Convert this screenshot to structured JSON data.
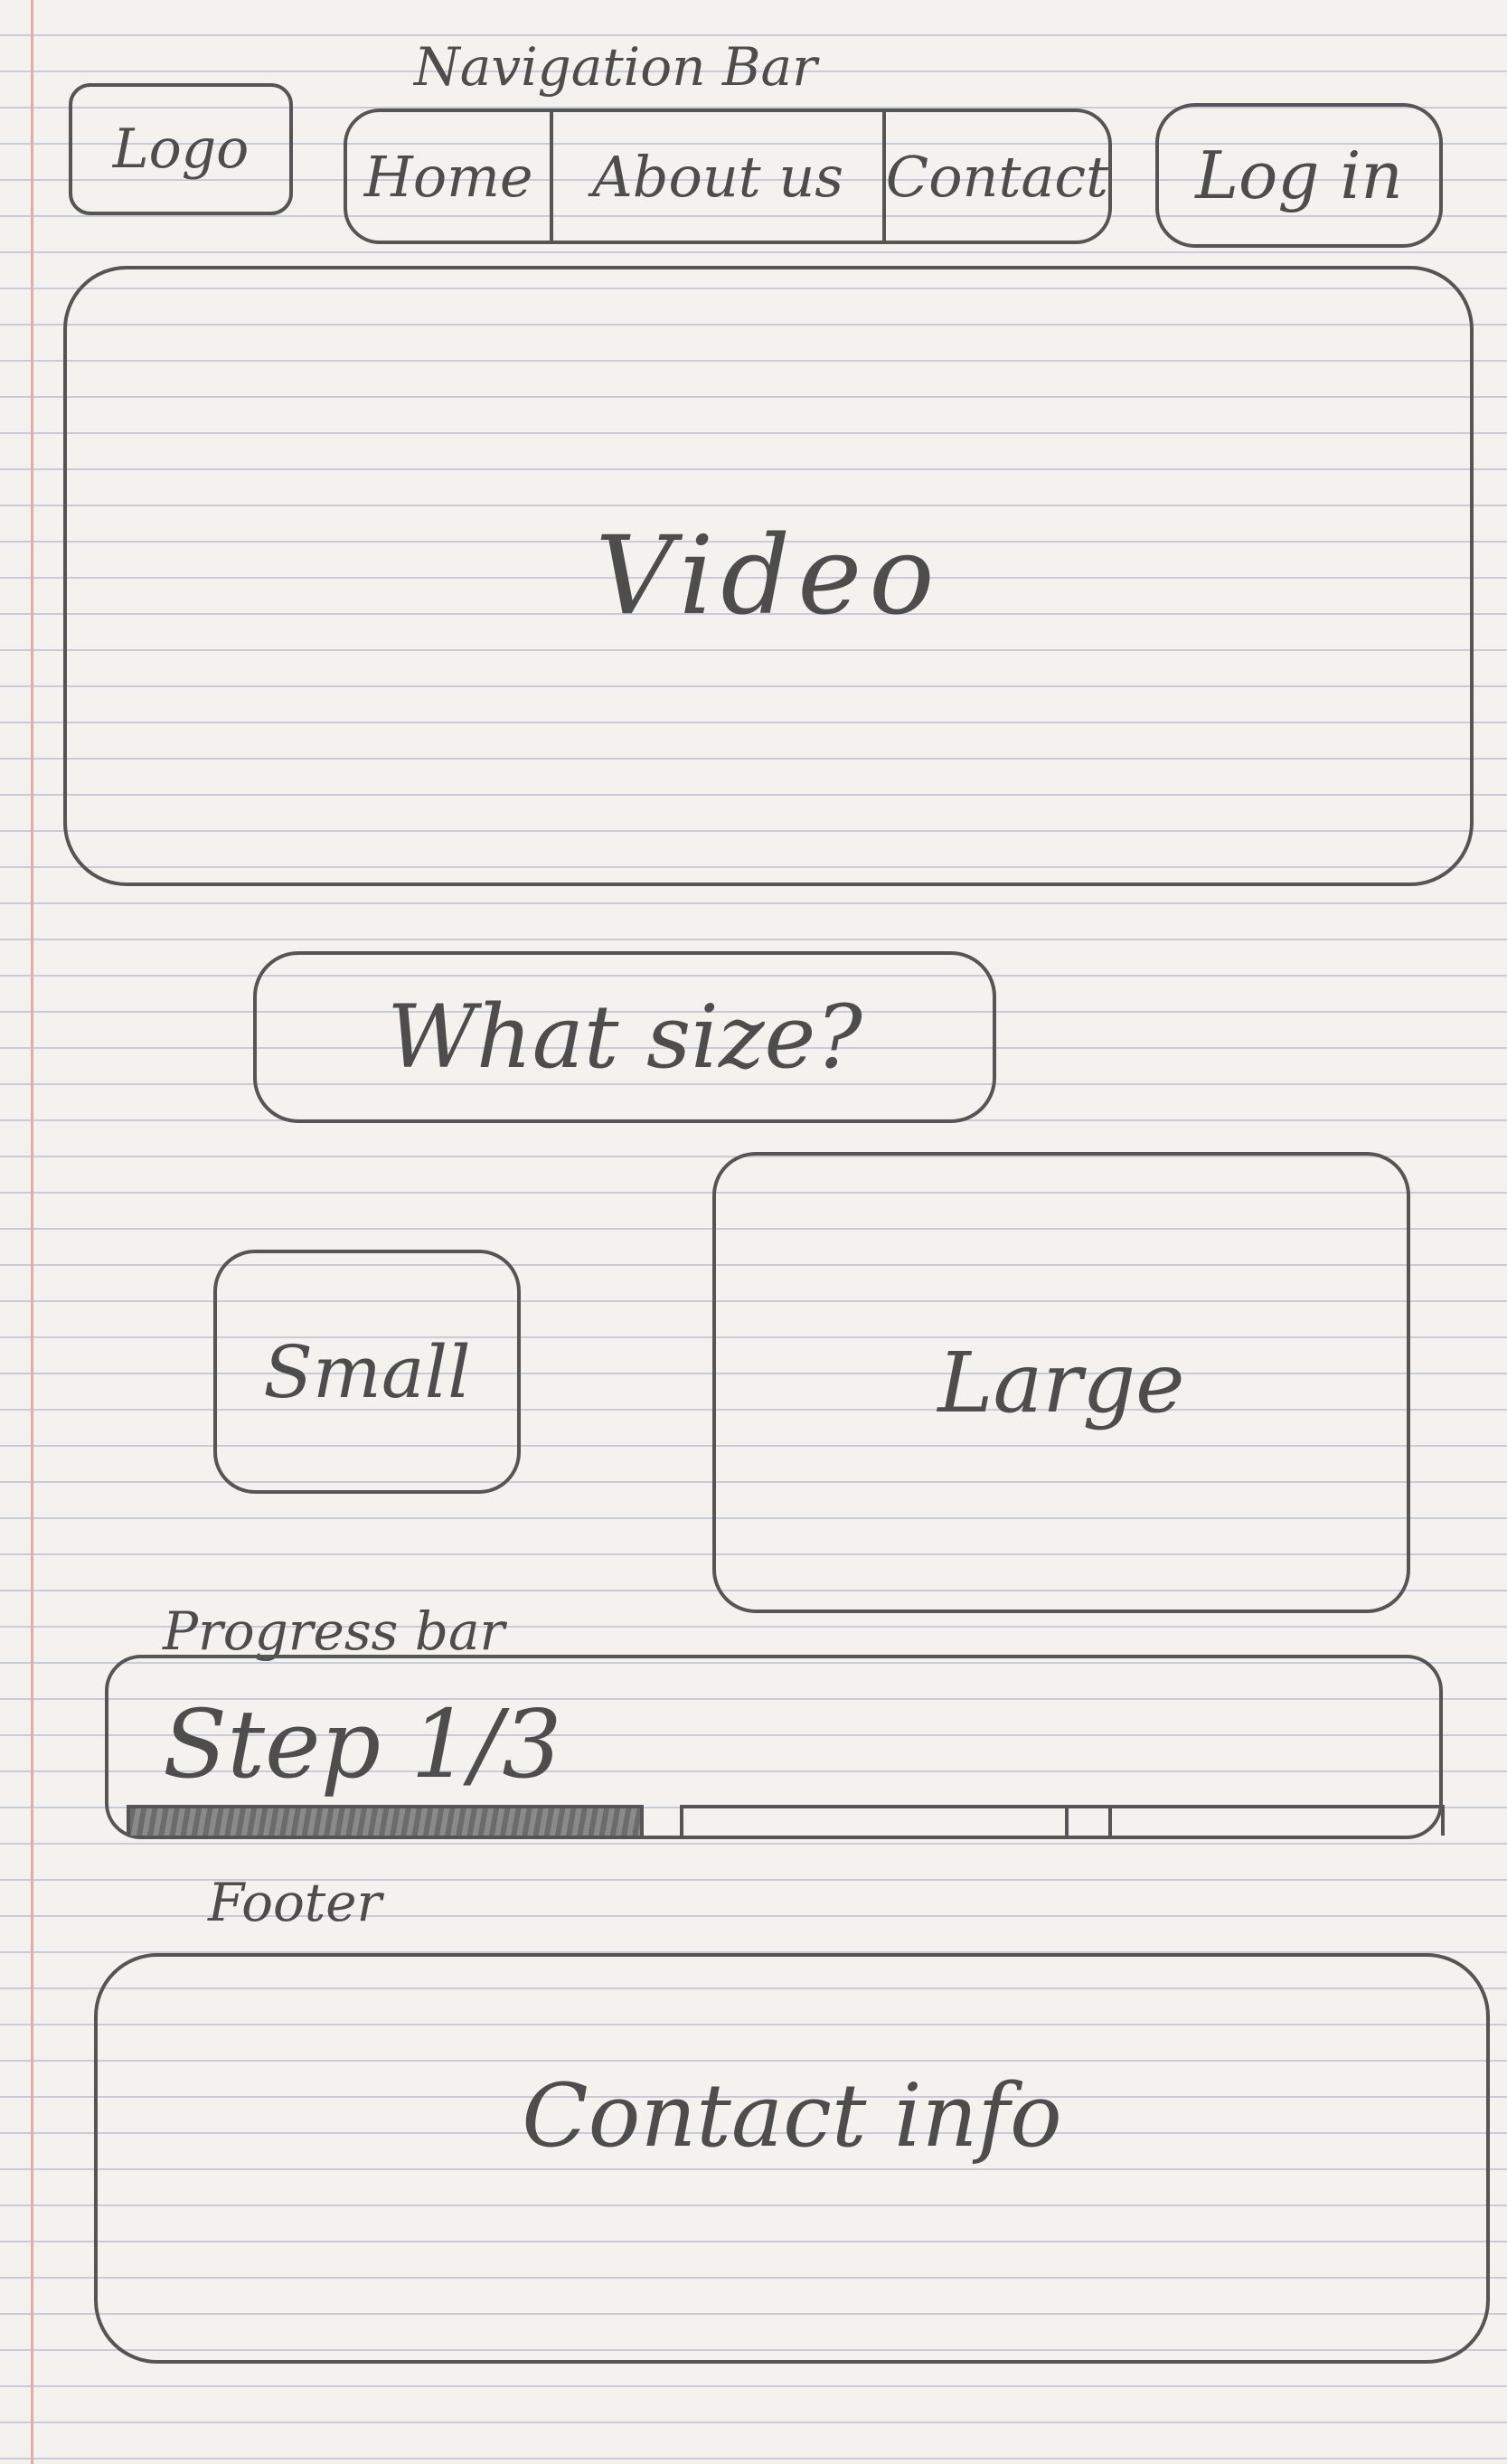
{
  "annotations": {
    "navigation": "Navigation Bar",
    "progress": "Progress bar",
    "footer": "Footer"
  },
  "header": {
    "logo": "Logo",
    "nav_items": [
      "Home",
      "About us",
      "Contact"
    ],
    "login": "Log in"
  },
  "video": {
    "label": "Video"
  },
  "question": {
    "text": "What size?"
  },
  "options": {
    "small": "Small",
    "large": "Large"
  },
  "progress": {
    "label": "Step 1/3",
    "completed_steps": 1,
    "total_steps": 3
  },
  "footer": {
    "text": "Contact info"
  }
}
